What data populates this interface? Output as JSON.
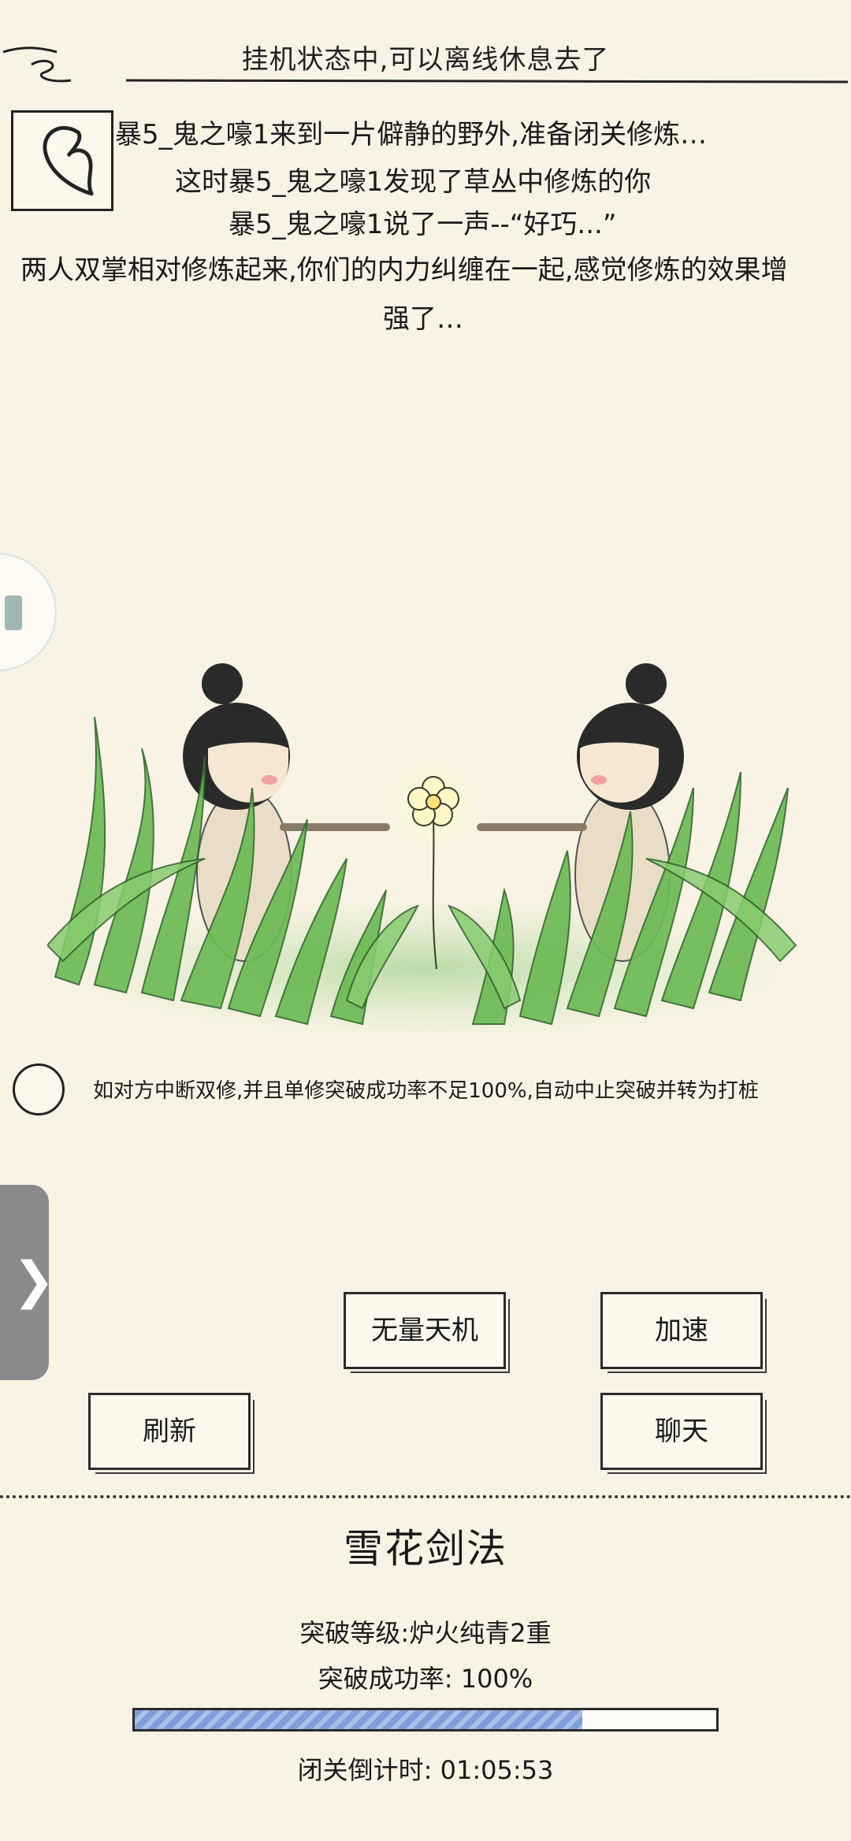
{
  "header": {
    "status_text": "挂机状态中,可以离线休息去了"
  },
  "story": {
    "lines": [
      "暴5_鬼之嚎1来到一片僻静的野外,准备闭关修炼…",
      "这时暴5_鬼之嚎1发现了草丛中修炼的你",
      "暴5_鬼之嚎1说了一声--“好巧...”",
      "两人双掌相对修炼起来,你们的内力纠缠在一起,感觉修炼的效果增",
      "强了…"
    ]
  },
  "option": {
    "label": "如对方中断双修,并且单修突破成功率不足100%,自动中止突破并转为打桩",
    "checked": false
  },
  "actions": {
    "wuliang_label": "无量天机",
    "speedup_label": "加速",
    "refresh_label": "刷新",
    "chat_label": "聊天"
  },
  "skill": {
    "name": "雪花剑法",
    "level_text": "突破等级:炉火纯青2重",
    "success_rate_text": "突破成功率: 100%",
    "progress_fraction": 0.77,
    "countdown_text": "闭关倒计时: 01:05:53"
  },
  "icons": {
    "avatar": "heart-outline-icon",
    "side_float": "floating-shortcut-icon",
    "side_tab": "chevron-right-icon"
  },
  "colors": {
    "background": "#f8f3e4",
    "progress_fill": "#7f9ed8",
    "grass": "#5fae4e"
  }
}
